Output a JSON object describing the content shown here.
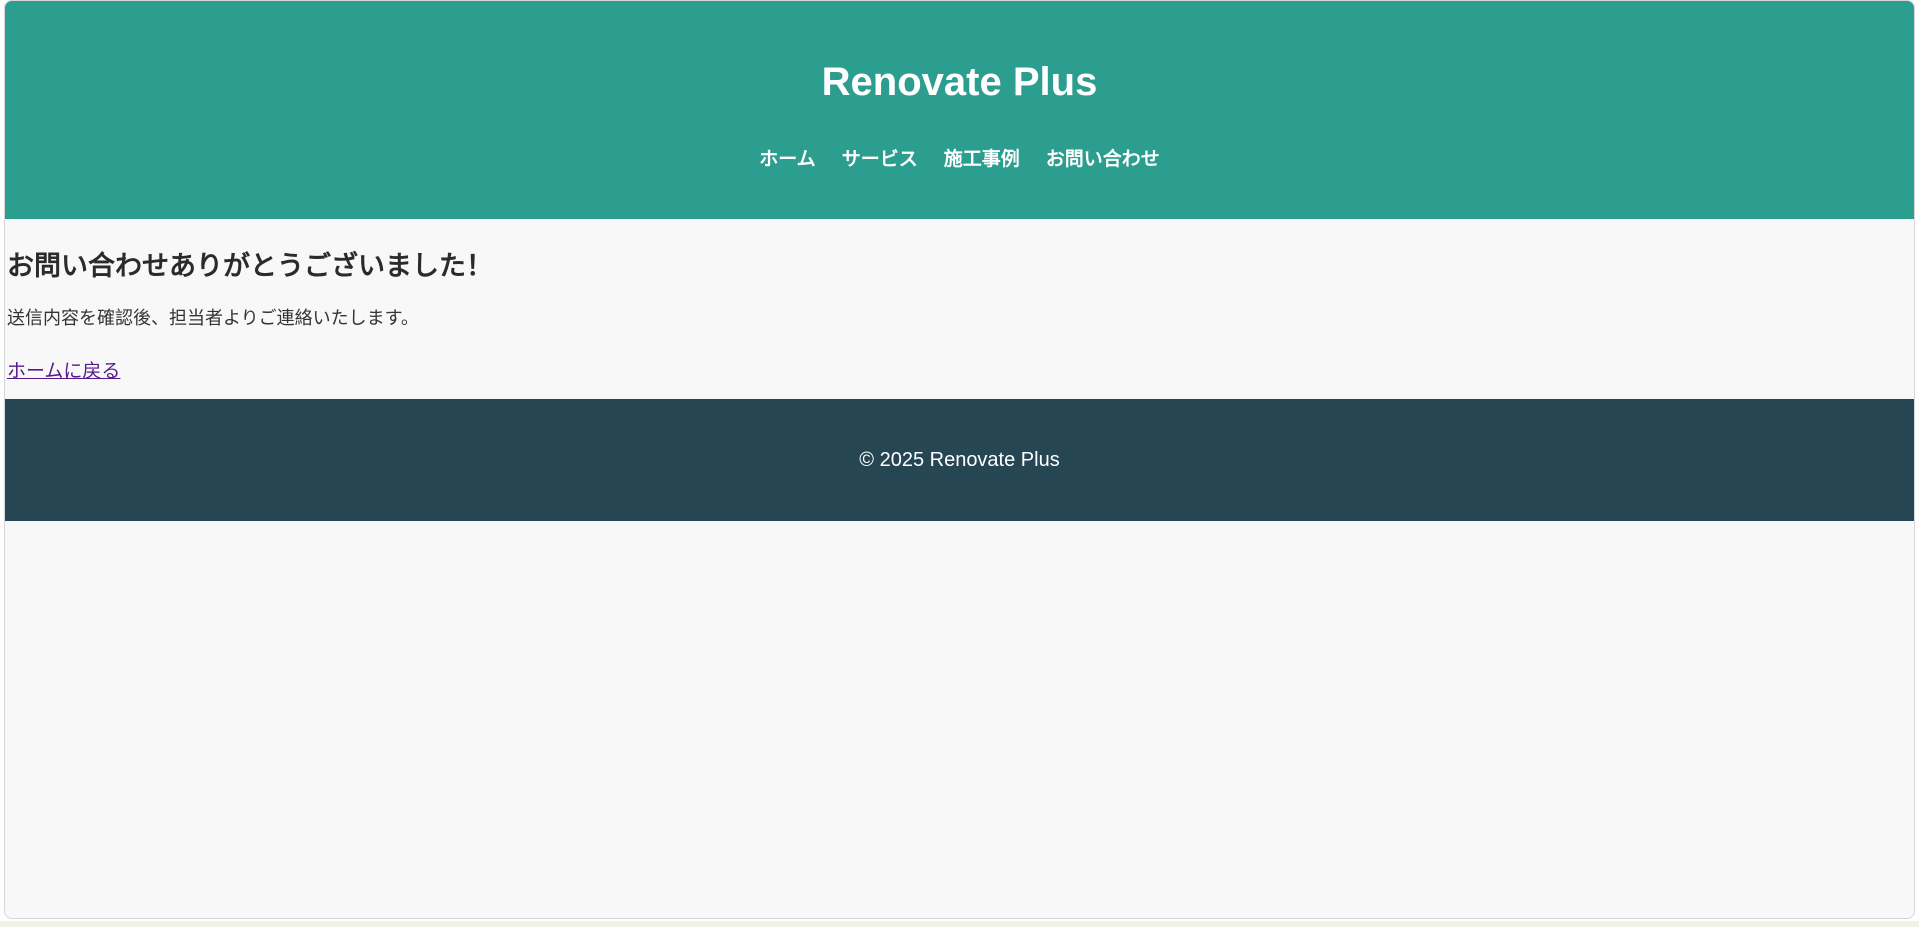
{
  "header": {
    "title": "Renovate Plus",
    "nav": [
      {
        "label": "ホーム"
      },
      {
        "label": "サービス"
      },
      {
        "label": "施工事例"
      },
      {
        "label": "お問い合わせ"
      }
    ]
  },
  "main": {
    "heading": "お問い合わせありがとうございました！",
    "message": "送信内容を確認後、担当者よりご連絡いたします。",
    "back_link": "ホームに戻る"
  },
  "footer": {
    "copyright": "© 2025 Renovate Plus"
  },
  "colors": {
    "header_bg": "#2c9e8f",
    "footer_bg": "#264653",
    "page_bg": "#f8f8f8",
    "link_visited": "#551a8b"
  }
}
